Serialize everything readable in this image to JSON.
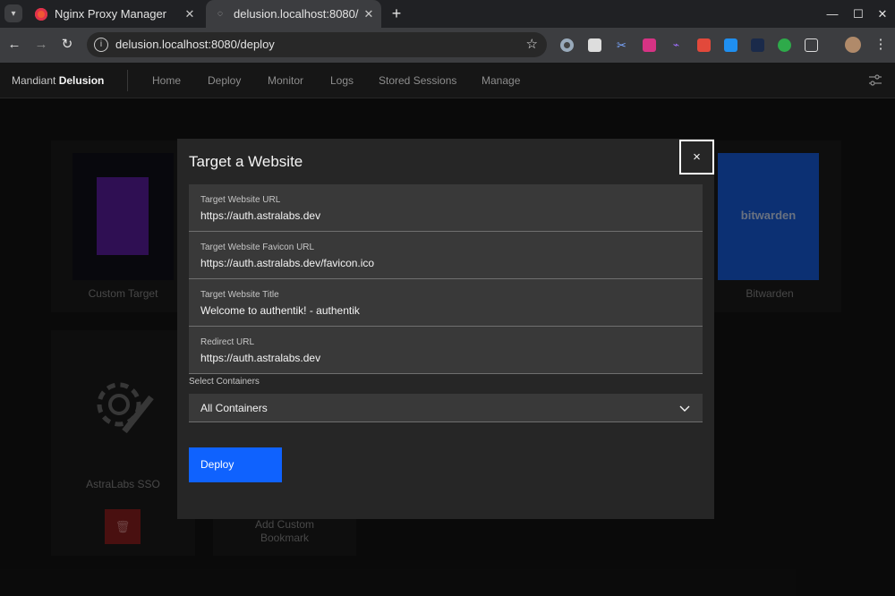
{
  "browser": {
    "tabs": [
      {
        "title": "Nginx Proxy Manager",
        "active": false
      },
      {
        "title": "delusion.localhost:8080/",
        "active": true
      }
    ],
    "new_tab": "+",
    "url": "delusion.localhost:8080/deploy"
  },
  "app": {
    "brand_prefix": "Mandiant",
    "brand_name": "Delusion",
    "nav": [
      "Home",
      "Deploy",
      "Monitor",
      "Logs",
      "Stored Sessions",
      "Manage"
    ]
  },
  "cards": {
    "custom_target": "Custom Target",
    "bitwarden": "Bitwarden",
    "bitwarden_logo": "bitwarden",
    "astralabs": "AstraLabs SSO",
    "add_bookmark": "Add Custom Bookmark"
  },
  "modal": {
    "title": "Target a Website",
    "close": "×",
    "fields": [
      {
        "label": "Target Website URL",
        "value": "https://auth.astralabs.dev"
      },
      {
        "label": "Target Website Favicon URL",
        "value": "https://auth.astralabs.dev/favicon.ico"
      },
      {
        "label": "Target Website Title",
        "value": "Welcome to authentik! - authentik"
      },
      {
        "label": "Redirect URL",
        "value": "https://auth.astralabs.dev"
      }
    ],
    "select_label": "Select Containers",
    "select_value": "All Containers",
    "deploy_label": "Deploy"
  },
  "colors": {
    "primary_button": "#0f62fe",
    "danger_button": "#8c1f1f",
    "bitwarden_blue": "#175ddc"
  }
}
